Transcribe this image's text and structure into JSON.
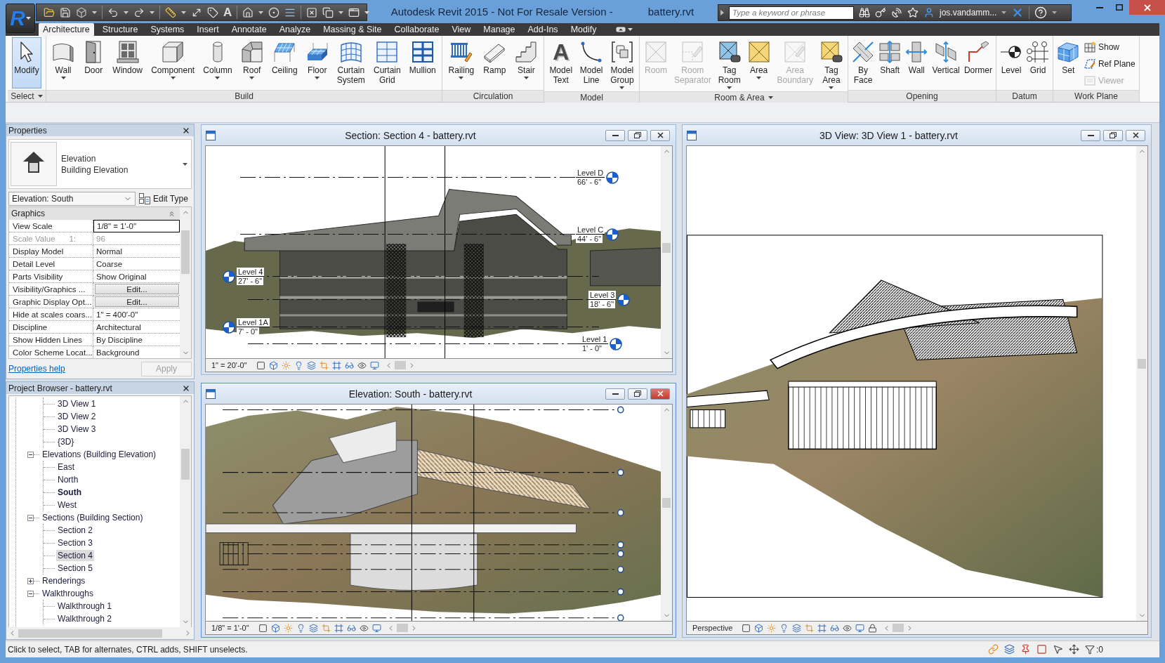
{
  "window": {
    "app_logo": "R",
    "title": "Autodesk Revit 2015 - Not For Resale Version -",
    "file": "battery.rvt"
  },
  "quick_access": {
    "text_tool": "A"
  },
  "info_center": {
    "search": {
      "placeholder": "Type a keyword or phrase"
    },
    "user": "jos.vandamm..."
  },
  "ribbon": {
    "tabs": [
      {
        "label": "Architecture",
        "selected": true
      },
      {
        "label": "Structure",
        "selected": false
      },
      {
        "label": "Systems",
        "selected": false
      },
      {
        "label": "Insert",
        "selected": false
      },
      {
        "label": "Annotate",
        "selected": false
      },
      {
        "label": "Analyze",
        "selected": false
      },
      {
        "label": "Massing & Site",
        "selected": false
      },
      {
        "label": "Collaborate",
        "selected": false
      },
      {
        "label": "View",
        "selected": false
      },
      {
        "label": "Manage",
        "selected": false
      },
      {
        "label": "Add-Ins",
        "selected": false
      },
      {
        "label": "Modify",
        "selected": false
      }
    ],
    "panels": [
      {
        "title": "Select",
        "menu": true,
        "tools": [
          {
            "label": "Modify",
            "kind": "large",
            "selected": true,
            "disabled": false,
            "dropdown": false
          }
        ]
      },
      {
        "title": "Build",
        "menu": false,
        "tools": [
          {
            "label": "Wall",
            "kind": "large",
            "selected": false,
            "disabled": false,
            "dropdown": true
          },
          {
            "label": "Door",
            "kind": "large",
            "selected": false,
            "disabled": false,
            "dropdown": false
          },
          {
            "label": "Window",
            "kind": "large",
            "selected": false,
            "disabled": false,
            "dropdown": false
          },
          {
            "label": "Component",
            "kind": "large",
            "selected": false,
            "disabled": false,
            "dropdown": true
          },
          {
            "label": "Column",
            "kind": "large",
            "selected": false,
            "disabled": false,
            "dropdown": true
          },
          {
            "label": "Roof",
            "kind": "large",
            "selected": false,
            "disabled": false,
            "dropdown": true
          },
          {
            "label": "Ceiling",
            "kind": "large",
            "selected": false,
            "disabled": false,
            "dropdown": false
          },
          {
            "label": "Floor",
            "kind": "large",
            "selected": false,
            "disabled": false,
            "dropdown": true
          },
          {
            "label": "Curtain System",
            "kind": "large",
            "selected": false,
            "disabled": false,
            "dropdown": false
          },
          {
            "label": "Curtain Grid",
            "kind": "large",
            "selected": false,
            "disabled": false,
            "dropdown": false
          },
          {
            "label": "Mullion",
            "kind": "large",
            "selected": false,
            "disabled": false,
            "dropdown": false
          }
        ]
      },
      {
        "title": "Circulation",
        "menu": false,
        "tools": [
          {
            "label": "Railing",
            "kind": "large",
            "selected": false,
            "disabled": false,
            "dropdown": true
          },
          {
            "label": "Ramp",
            "kind": "large",
            "selected": false,
            "disabled": false,
            "dropdown": false
          },
          {
            "label": "Stair",
            "kind": "large",
            "selected": false,
            "disabled": false,
            "dropdown": true
          }
        ]
      },
      {
        "title": "Model",
        "menu": false,
        "tools": [
          {
            "label": "Model Text",
            "glyph": "A",
            "kind": "large",
            "selected": false,
            "disabled": false,
            "dropdown": false
          },
          {
            "label": "Model Line",
            "kind": "large",
            "selected": false,
            "disabled": false,
            "dropdown": false
          },
          {
            "label": "Model Group",
            "kind": "large",
            "selected": false,
            "disabled": false,
            "dropdown": true
          }
        ]
      },
      {
        "title": "Room & Area",
        "menu": true,
        "tools": [
          {
            "label": "Room",
            "kind": "large",
            "selected": false,
            "disabled": true,
            "dropdown": false
          },
          {
            "label": "Room Separator",
            "kind": "large",
            "selected": false,
            "disabled": true,
            "dropdown": false
          },
          {
            "label": "Tag Room",
            "kind": "large",
            "selected": false,
            "disabled": false,
            "dropdown": true
          },
          {
            "label": "Area",
            "kind": "large",
            "selected": false,
            "disabled": false,
            "dropdown": true
          },
          {
            "label": "Area Boundary",
            "kind": "large",
            "selected": false,
            "disabled": true,
            "dropdown": false
          },
          {
            "label": "Tag Area",
            "kind": "large",
            "selected": false,
            "disabled": false,
            "dropdown": true
          }
        ]
      },
      {
        "title": "Opening",
        "menu": false,
        "tools": [
          {
            "label": "By Face",
            "kind": "large",
            "selected": false,
            "disabled": false,
            "dropdown": false
          },
          {
            "label": "Shaft",
            "kind": "large",
            "selected": false,
            "disabled": false,
            "dropdown": false
          },
          {
            "label": "Wall",
            "kind": "large",
            "selected": false,
            "disabled": false,
            "dropdown": false
          },
          {
            "label": "Vertical",
            "kind": "large",
            "selected": false,
            "disabled": false,
            "dropdown": false
          },
          {
            "label": "Dormer",
            "kind": "large",
            "selected": false,
            "disabled": false,
            "dropdown": false
          }
        ]
      },
      {
        "title": "Datum",
        "menu": false,
        "tools": [
          {
            "label": "Level",
            "kind": "large",
            "selected": false,
            "disabled": false,
            "dropdown": false
          },
          {
            "label": "Grid",
            "kind": "large",
            "selected": false,
            "disabled": false,
            "dropdown": false
          }
        ]
      },
      {
        "title": "Work Plane",
        "menu": false,
        "tools": [
          {
            "label": "Set",
            "kind": "large",
            "selected": false,
            "disabled": false,
            "dropdown": false
          },
          {
            "label": "Show",
            "kind": "small",
            "selected": false,
            "disabled": false,
            "dropdown": false
          },
          {
            "label": "Ref Plane",
            "kind": "small",
            "selected": false,
            "disabled": false,
            "dropdown": false
          },
          {
            "label": "Viewer",
            "kind": "small",
            "selected": false,
            "disabled": true,
            "dropdown": false
          }
        ]
      }
    ]
  },
  "properties": {
    "title": "Properties",
    "type": {
      "category": "Elevation",
      "family": "Building Elevation"
    },
    "instance": "Elevation: South",
    "edit_type": "Edit Type",
    "group": {
      "label": "Graphics",
      "expanded": true
    },
    "rows": [
      {
        "name": "View Scale",
        "value": "1/8\" = 1'-0\"",
        "kind": "text",
        "disabled": false,
        "focused": true
      },
      {
        "name": "Scale Value",
        "suffix": "1:",
        "value": "96",
        "kind": "text",
        "disabled": true,
        "focused": false
      },
      {
        "name": "Display Model",
        "value": "Normal",
        "kind": "text",
        "disabled": false,
        "focused": false
      },
      {
        "name": "Detail Level",
        "value": "Coarse",
        "kind": "text",
        "disabled": false,
        "focused": false
      },
      {
        "name": "Parts Visibility",
        "value": "Show Original",
        "kind": "text",
        "disabled": false,
        "focused": false
      },
      {
        "name": "Visibility/Graphics ...",
        "value": "Edit...",
        "kind": "button",
        "disabled": false,
        "focused": false
      },
      {
        "name": "Graphic Display Opt...",
        "value": "Edit...",
        "kind": "button",
        "disabled": false,
        "focused": false
      },
      {
        "name": "Hide at scales coars...",
        "value": "1\" = 400'-0\"",
        "kind": "text",
        "disabled": false,
        "focused": false
      },
      {
        "name": "Discipline",
        "value": "Architectural",
        "kind": "text",
        "disabled": false,
        "focused": false
      },
      {
        "name": "Show Hidden Lines",
        "value": "By Discipline",
        "kind": "text",
        "disabled": false,
        "focused": false
      },
      {
        "name": "Color Scheme Locat...",
        "value": "Background",
        "kind": "text",
        "disabled": false,
        "focused": false
      }
    ],
    "help": "Properties help",
    "apply": {
      "label": "Apply",
      "disabled": true
    }
  },
  "project_browser": {
    "title": "Project Browser - battery.rvt",
    "tree": [
      {
        "children": [
          {
            "label": "3D View 1",
            "selected": false,
            "active": false
          },
          {
            "label": "3D View 2",
            "selected": false,
            "active": false
          },
          {
            "label": "3D View 3",
            "selected": false,
            "active": false
          },
          {
            "label": "{3D}",
            "selected": false,
            "active": false
          }
        ]
      },
      {
        "label": "Elevations (Building Elevation)",
        "selected": false,
        "expanded": true,
        "children": [
          {
            "label": "East",
            "selected": false,
            "active": false
          },
          {
            "label": "North",
            "selected": false,
            "active": false
          },
          {
            "label": "South",
            "selected": false,
            "active": true
          },
          {
            "label": "West",
            "selected": false,
            "active": false
          }
        ]
      },
      {
        "label": "Sections (Building Section)",
        "selected": false,
        "expanded": true,
        "children": [
          {
            "label": "Section 2",
            "selected": false,
            "active": false
          },
          {
            "label": "Section 3",
            "selected": false,
            "active": false
          },
          {
            "label": "Section 4",
            "selected": true,
            "active": false
          },
          {
            "label": "Section 5",
            "selected": false,
            "active": false
          }
        ]
      },
      {
        "label": "Renderings",
        "selected": false,
        "expanded": false
      },
      {
        "label": "Walkthroughs",
        "selected": false,
        "expanded": true,
        "children": [
          {
            "label": "Walkthrough 1",
            "selected": false,
            "active": false
          },
          {
            "label": "Walkthrough 2",
            "selected": false,
            "active": false
          }
        ]
      }
    ]
  },
  "views": [
    {
      "kind": "section",
      "title": "Section: Section 4 - battery.rvt",
      "active": false,
      "scale": "1\" = 20'-0\"",
      "levels": [
        {
          "name": "Level D",
          "elevation": "66' - 6\""
        },
        {
          "name": "Level C",
          "elevation": "44' - 6\""
        },
        {
          "name": "Level 4",
          "elevation": "27' - 6\""
        },
        {
          "name": "Level 3",
          "elevation": "18' - 6\""
        },
        {
          "name": "Level 1A",
          "elevation": "7' - 0\""
        },
        {
          "name": "Level 1",
          "elevation": "1' - 0\""
        }
      ]
    },
    {
      "kind": "elevation",
      "title": "Elevation: South - battery.rvt",
      "active": true,
      "scale": "1/8\" = 1'-0\""
    },
    {
      "kind": "perspective",
      "title": "3D View: 3D View 1 - battery.rvt",
      "active": false,
      "projection": "Perspective"
    }
  ],
  "status_bar": {
    "message": "Click to select, TAB for alternates, CTRL adds, SHIFT unselects.",
    "selection_count": ":0"
  }
}
